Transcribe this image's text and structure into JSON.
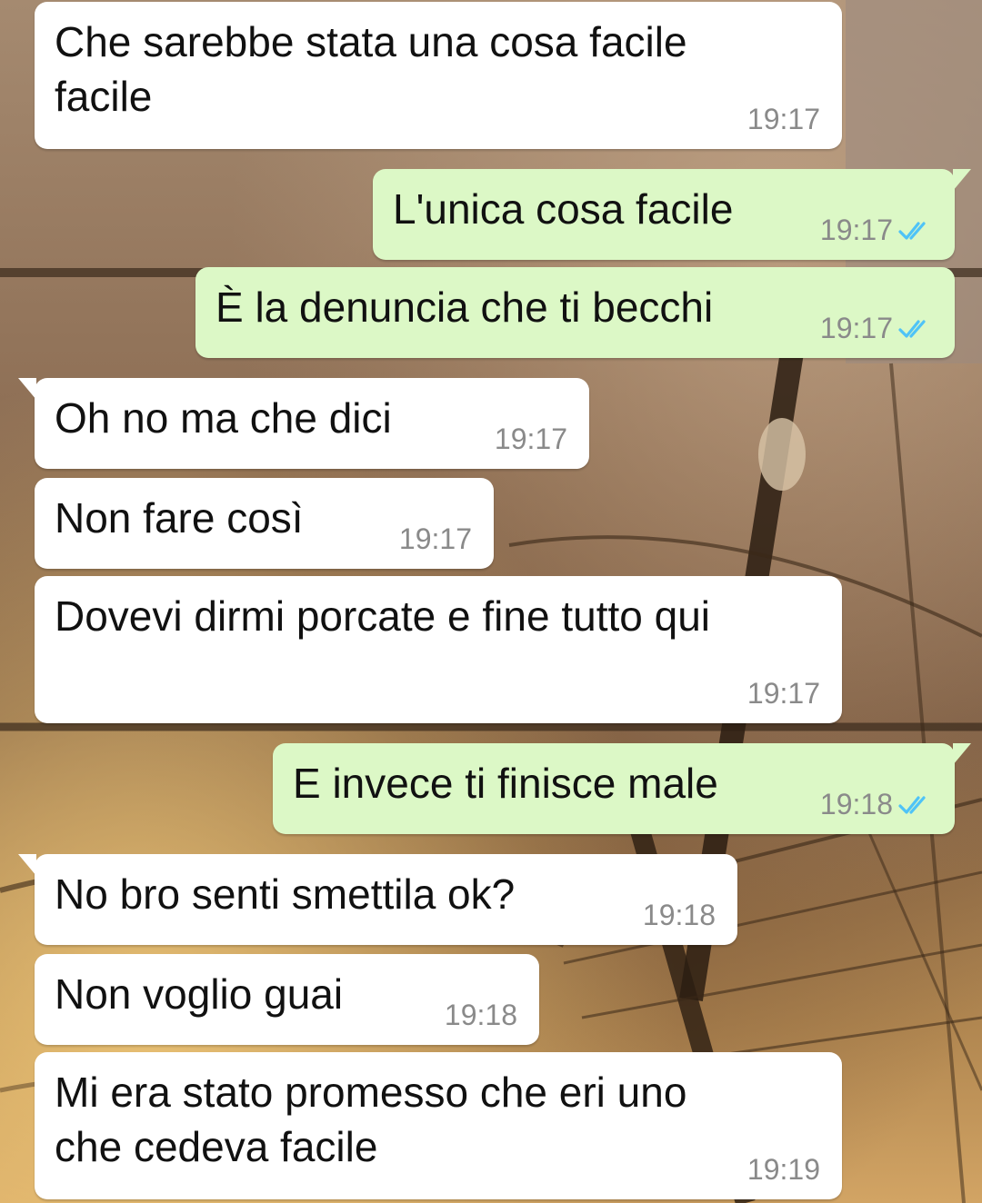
{
  "colors": {
    "incoming_bubble": "#ffffff",
    "outgoing_bubble": "#dcf8c6",
    "read_ticks": "#4fc3f7",
    "timestamp": "#8a8a8a"
  },
  "messages": [
    {
      "direction": "in",
      "text": "Che sarebbe stata una cosa facile\nfacile",
      "time": "19:17"
    },
    {
      "direction": "out",
      "text": "L'unica cosa facile",
      "time": "19:17",
      "status": "read"
    },
    {
      "direction": "out",
      "text": "È la denuncia che ti becchi",
      "time": "19:17",
      "status": "read"
    },
    {
      "direction": "in",
      "text": "Oh no ma che dici",
      "time": "19:17"
    },
    {
      "direction": "in",
      "text": "Non fare così",
      "time": "19:17"
    },
    {
      "direction": "in",
      "text": "Dovevi dirmi porcate e fine tutto qui",
      "time": "19:17"
    },
    {
      "direction": "out",
      "text": "E invece ti finisce male",
      "time": "19:18",
      "status": "read"
    },
    {
      "direction": "in",
      "text": "No bro senti smettila ok?",
      "time": "19:18"
    },
    {
      "direction": "in",
      "text": "Non voglio guai",
      "time": "19:18"
    },
    {
      "direction": "in",
      "text": "Mi era stato promesso che eri uno\nche cedeva facile",
      "time": "19:19"
    }
  ]
}
